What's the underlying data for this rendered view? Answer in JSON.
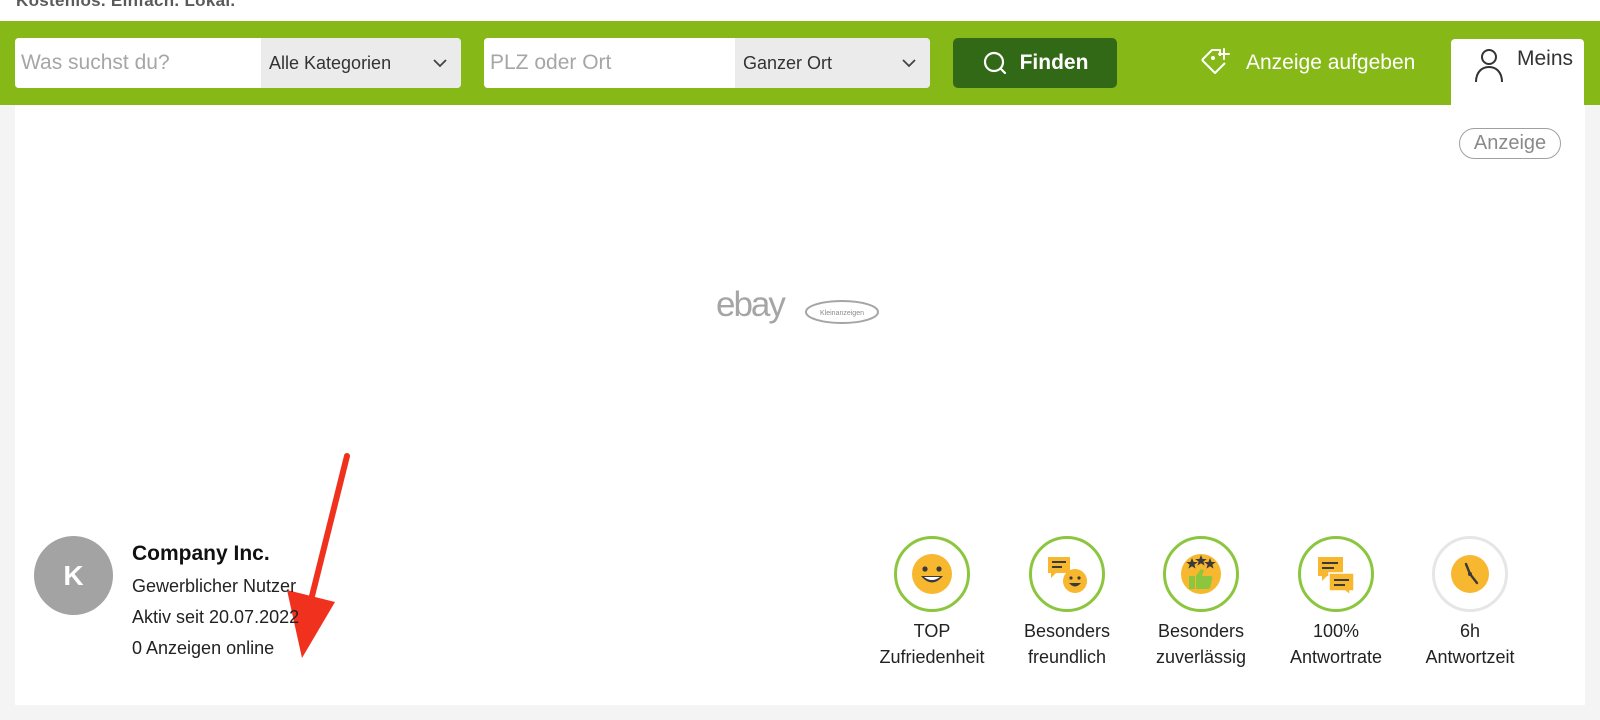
{
  "top_strip_text": "Kostenlos. Einfach. Lokal.",
  "header": {
    "search_placeholder": "Was suchst du?",
    "category_select": "Alle Kategorien",
    "location_placeholder": "PLZ oder Ort",
    "radius_select": "Ganzer Ort",
    "find_button": "Finden",
    "post_ad_button": "Anzeige aufgeben",
    "account_button": "Meins",
    "brand_color": "#86b817",
    "button_color": "#326916"
  },
  "ad": {
    "label": "Anzeige",
    "logo_text": "ebay",
    "logo_badge": "Kleinanzeigen"
  },
  "profile": {
    "avatar_letter": "K",
    "name": "Company Inc.",
    "type": "Gewerblicher Nutzer",
    "active_since": "Aktiv seit 20.07.2022",
    "ads_online": "0 Anzeigen online"
  },
  "badges": [
    {
      "icon": "smiley-icon",
      "line1": "TOP",
      "line2": "Zufriedenheit"
    },
    {
      "icon": "chat-smiley-icon",
      "line1": "Besonders",
      "line2": "freundlich"
    },
    {
      "icon": "thumbs-up-stars-icon",
      "line1": "Besonders",
      "line2": "zuverlässig"
    },
    {
      "icon": "message-icon",
      "line1": "100%",
      "line2": "Antwortrate"
    },
    {
      "icon": "clock-icon",
      "line1": "6h",
      "line2": "Antwortzeit"
    }
  ],
  "annotation_color": "#f0311e"
}
